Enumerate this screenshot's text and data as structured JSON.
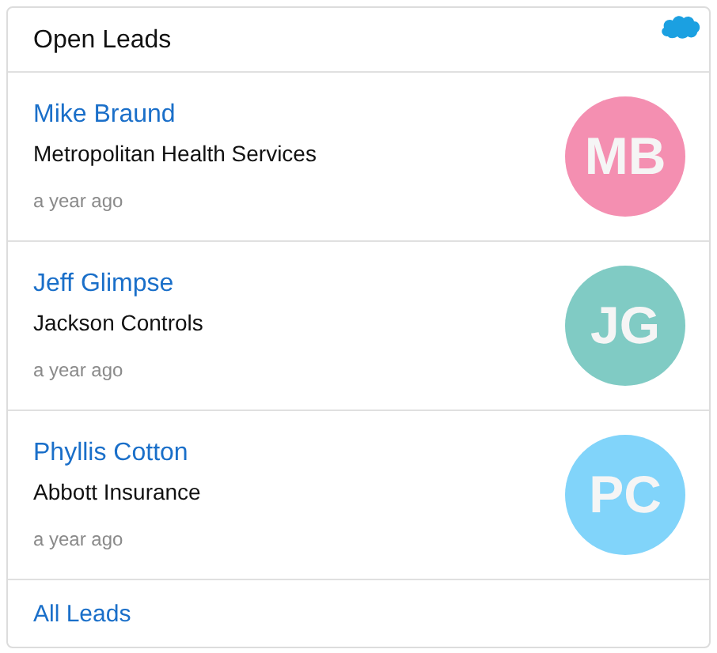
{
  "card": {
    "title": "Open Leads"
  },
  "leads": [
    {
      "name": "Mike Braund",
      "company": "Metropolitan Health Services",
      "time": "a year ago",
      "initials": "MB",
      "color": "#f48fb1"
    },
    {
      "name": "Jeff Glimpse",
      "company": "Jackson Controls",
      "time": "a year ago",
      "initials": "JG",
      "color": "#80cbc4"
    },
    {
      "name": "Phyllis Cotton",
      "company": "Abbott Insurance",
      "time": "a year ago",
      "initials": "PC",
      "color": "#81d4fa"
    }
  ],
  "footer": {
    "link": "All Leads"
  }
}
